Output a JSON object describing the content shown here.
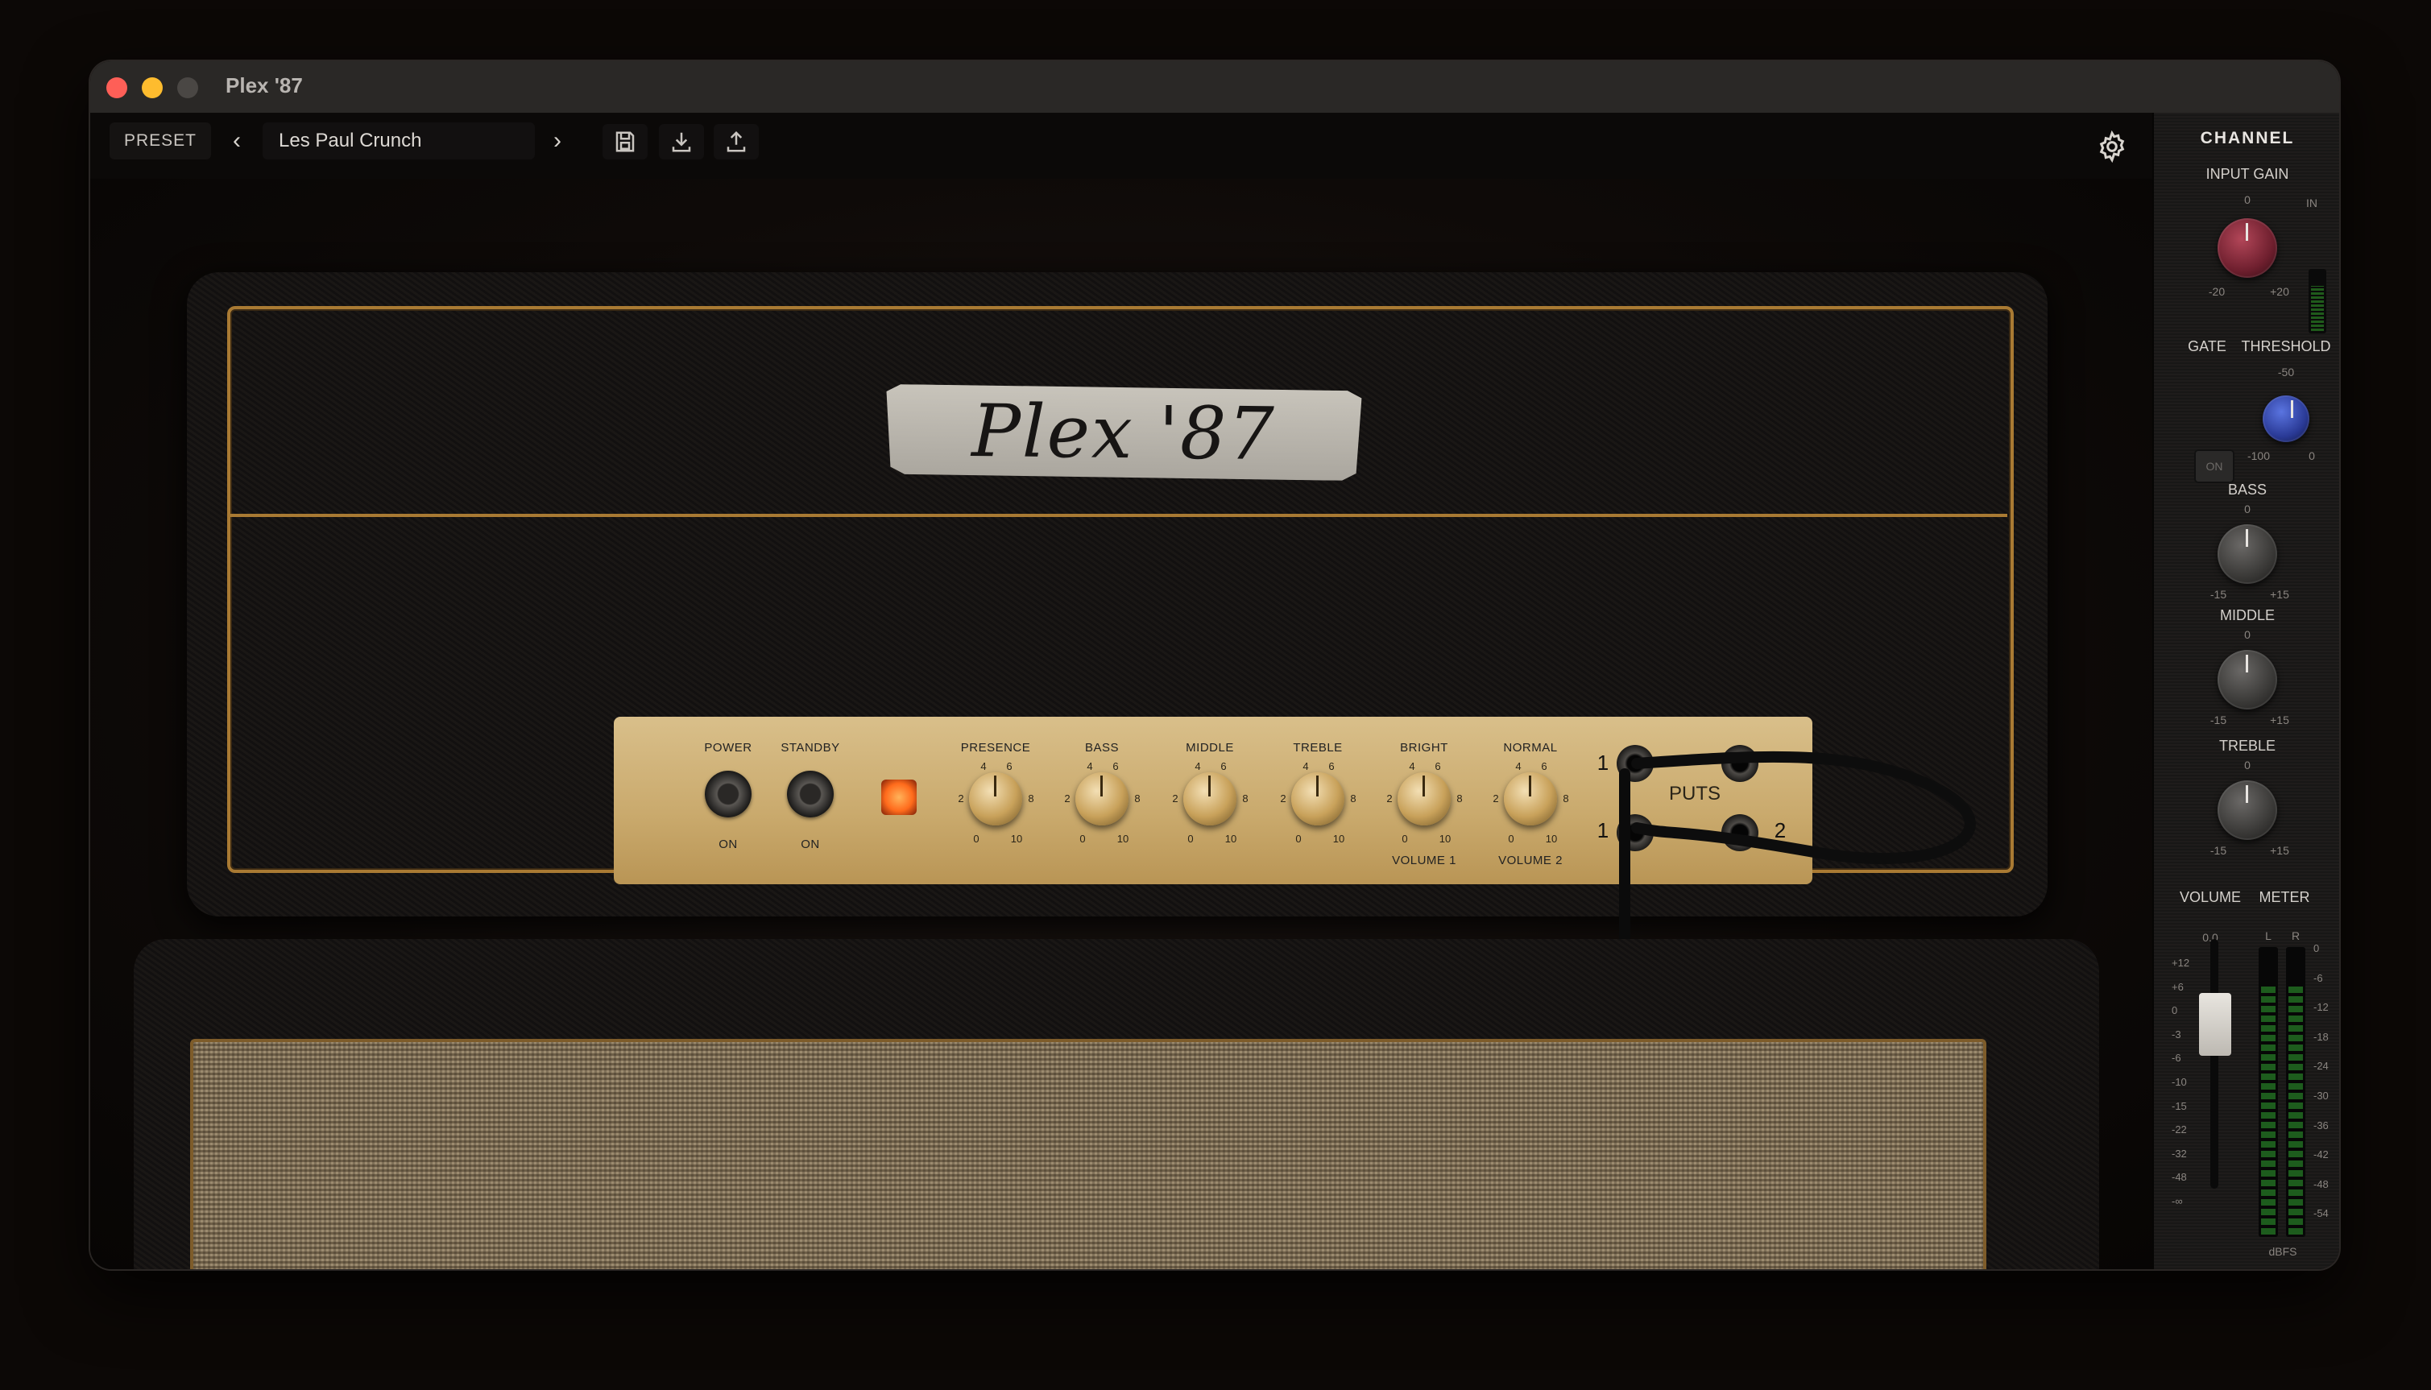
{
  "window": {
    "title": "Plex '87"
  },
  "toolbar": {
    "preset_label": "PRESET",
    "preset_name": "Les Paul Crunch",
    "prev_icon": "chevron-left-icon",
    "next_icon": "chevron-right-icon",
    "save_icon": "save-icon",
    "download_icon": "download-icon",
    "upload_icon": "upload-icon",
    "settings_icon": "gear-icon"
  },
  "amp": {
    "logo": "Plex '87",
    "power": {
      "label": "POWER",
      "state": "ON"
    },
    "standby": {
      "label": "STANDBY",
      "state": "ON"
    },
    "knobs": [
      {
        "label": "PRESENCE"
      },
      {
        "label": "BASS"
      },
      {
        "label": "MIDDLE"
      },
      {
        "label": "TREBLE"
      },
      {
        "label": "BRIGHT",
        "sub": "VOLUME 1"
      },
      {
        "label": "NORMAL",
        "sub": "VOLUME 2"
      }
    ],
    "knob_ticks": {
      "t0": "0",
      "t2": "2",
      "t4": "4",
      "t6": "6",
      "t8": "8",
      "t10": "10"
    },
    "inputs_label": "PUTS",
    "jack_numbers": [
      "1",
      "1",
      "2"
    ]
  },
  "channel": {
    "title": "CHANNEL",
    "input_gain": {
      "label": "INPUT GAIN",
      "top": "0",
      "min": "-20",
      "max": "+20",
      "in_label": "IN",
      "color": "#8a2a3c"
    },
    "gate": {
      "label": "GATE",
      "button": "ON"
    },
    "threshold": {
      "label": "THRESHOLD",
      "top": "-50",
      "min": "-100",
      "max": "0",
      "color": "#2e3f9a"
    },
    "bass": {
      "label": "BASS",
      "top": "0",
      "min": "-15",
      "max": "+15"
    },
    "middle": {
      "label": "MIDDLE",
      "top": "0",
      "min": "-15",
      "max": "+15"
    },
    "treble": {
      "label": "TREBLE",
      "top": "0",
      "min": "-15",
      "max": "+15"
    },
    "volume": {
      "label": "VOLUME",
      "value": "0.0",
      "scale": [
        "+12",
        "+6",
        "0",
        "-3",
        "-6",
        "-10",
        "-15",
        "-22",
        "-32",
        "-48",
        "-∞"
      ]
    },
    "meter": {
      "label": "METER",
      "left": "L",
      "right": "R",
      "unit": "dBFS",
      "scale": [
        "0",
        "-6",
        "-12",
        "-18",
        "-24",
        "-30",
        "-36",
        "-42",
        "-48",
        "-54"
      ]
    }
  }
}
